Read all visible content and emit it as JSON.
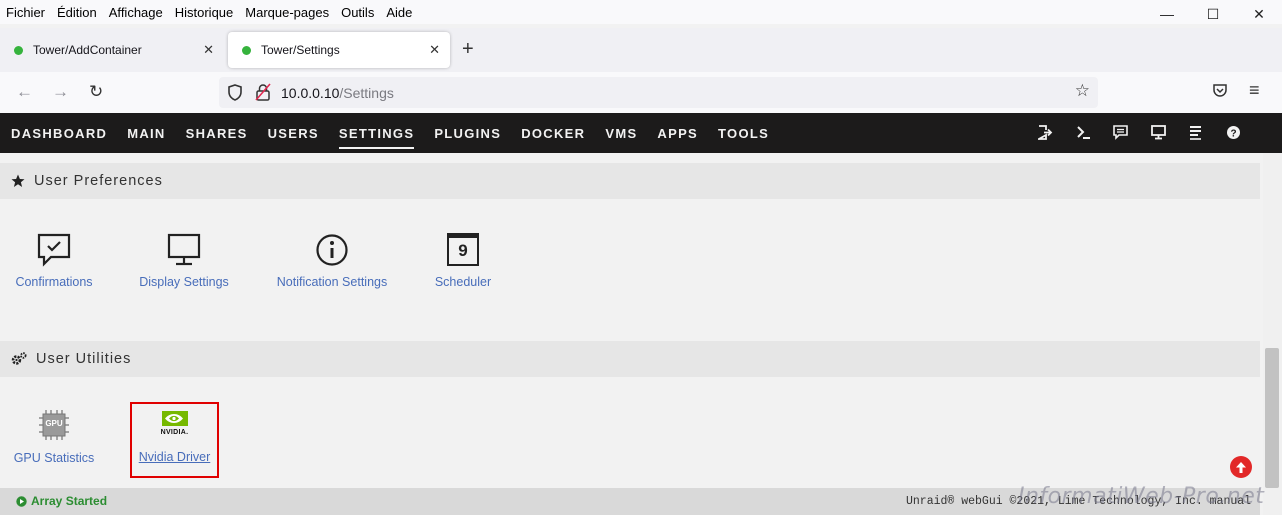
{
  "browser": {
    "menu": [
      "Fichier",
      "Édition",
      "Affichage",
      "Historique",
      "Marque-pages",
      "Outils",
      "Aide"
    ],
    "tabs": [
      {
        "title": "Tower/AddContainer",
        "active": false
      },
      {
        "title": "Tower/Settings",
        "active": true
      }
    ],
    "url_host": "10.0.0.10",
    "url_path": "/Settings"
  },
  "unraid_nav": [
    "DASHBOARD",
    "MAIN",
    "SHARES",
    "USERS",
    "SETTINGS",
    "PLUGINS",
    "DOCKER",
    "VMS",
    "APPS",
    "TOOLS"
  ],
  "active_nav": "SETTINGS",
  "sections": {
    "user_preferences": {
      "title": "User Preferences",
      "items": [
        "Confirmations",
        "Display Settings",
        "Notification Settings",
        "Scheduler"
      ]
    },
    "user_utilities": {
      "title": "User Utilities",
      "items": [
        "GPU Statistics",
        "Nvidia Driver"
      ]
    }
  },
  "icons": {
    "scheduler_day": "9",
    "gpu_chip": "GPU",
    "nvidia_logo": "NVIDIA."
  },
  "footer": {
    "status": "Array Started",
    "copyright": "Unraid® webGui ©2021, Lime Technology, Inc. manual"
  },
  "watermark": "InformatiWeb-Pro.net",
  "colors": {
    "link": "#486dba",
    "header_bg": "#1c1b1b",
    "status_green": "#2c8d32",
    "highlight_red": "#e00000"
  }
}
